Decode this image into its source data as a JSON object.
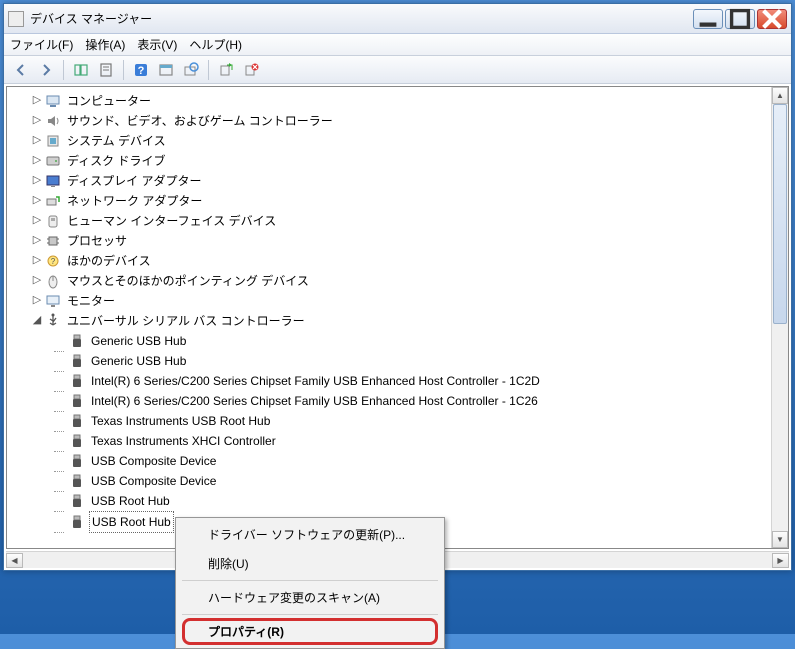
{
  "window": {
    "title": "デバイス マネージャー"
  },
  "menu": {
    "file": "ファイル(F)",
    "action": "操作(A)",
    "view": "表示(V)",
    "help": "ヘルプ(H)"
  },
  "tree": {
    "nodes": [
      {
        "label": "コンピューター",
        "icon": "computer"
      },
      {
        "label": "サウンド、ビデオ、およびゲーム コントローラー",
        "icon": "sound"
      },
      {
        "label": "システム デバイス",
        "icon": "system"
      },
      {
        "label": "ディスク ドライブ",
        "icon": "disk"
      },
      {
        "label": "ディスプレイ アダプター",
        "icon": "display"
      },
      {
        "label": "ネットワーク アダプター",
        "icon": "network"
      },
      {
        "label": "ヒューマン インターフェイス デバイス",
        "icon": "hid"
      },
      {
        "label": "プロセッサ",
        "icon": "cpu"
      },
      {
        "label": "ほかのデバイス",
        "icon": "other"
      },
      {
        "label": "マウスとそのほかのポインティング デバイス",
        "icon": "mouse"
      },
      {
        "label": "モニター",
        "icon": "monitor"
      },
      {
        "label": "ユニバーサル シリアル バス コントローラー",
        "icon": "usb"
      }
    ],
    "usb_children": [
      "Generic USB Hub",
      "Generic USB Hub",
      "Intel(R) 6 Series/C200 Series Chipset Family USB Enhanced Host Controller - 1C2D",
      "Intel(R) 6 Series/C200 Series Chipset Family USB Enhanced Host Controller - 1C26",
      "Texas Instruments USB Root Hub",
      "Texas Instruments XHCI Controller",
      "USB Composite Device",
      "USB Composite Device",
      "USB Root Hub",
      "USB Root Hub"
    ],
    "selected_index": 9
  },
  "context_menu": {
    "update_driver": "ドライバー ソフトウェアの更新(P)...",
    "delete": "削除(U)",
    "scan": "ハードウェア変更のスキャン(A)",
    "properties": "プロパティ(R)"
  }
}
